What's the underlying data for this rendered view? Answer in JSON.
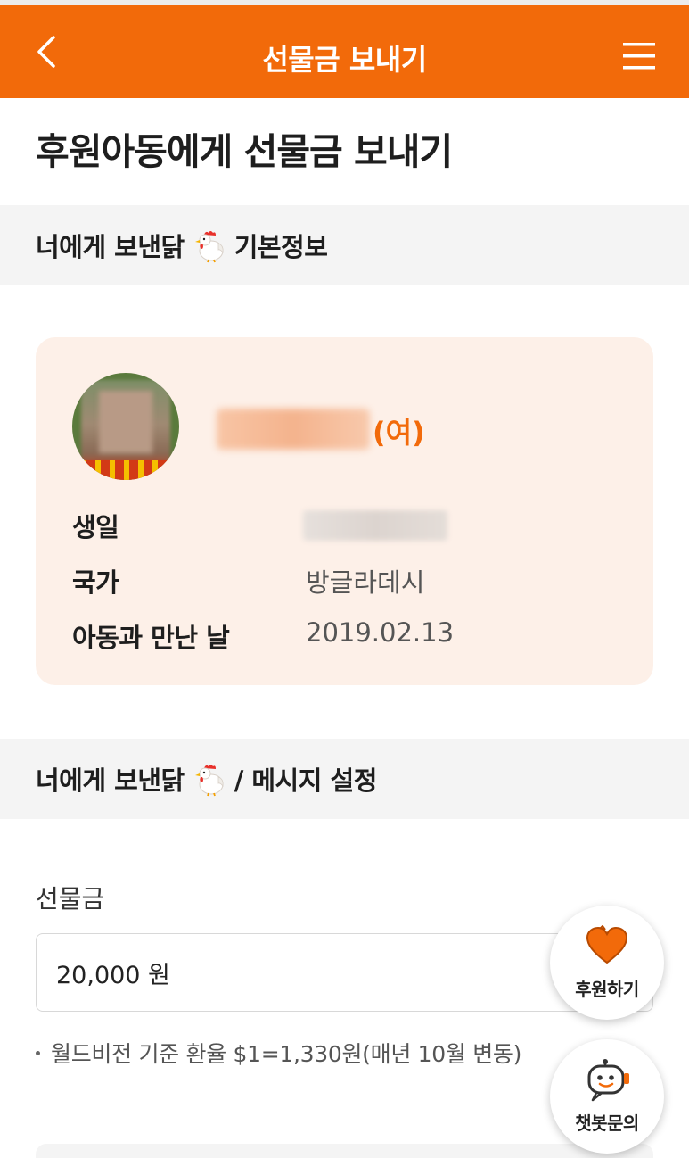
{
  "header": {
    "title": "선물금 보내기",
    "back_icon": "chevron-left-icon",
    "menu_icon": "hamburger-menu-icon"
  },
  "page": {
    "title": "후원아동에게 선물금 보내기"
  },
  "section_basic": {
    "title_prefix": "너에게 보낸닭",
    "title_suffix": "기본정보"
  },
  "child": {
    "gender": "(여)",
    "rows": [
      {
        "label": "생일",
        "value": ""
      },
      {
        "label": "국가",
        "value": "방글라데시"
      },
      {
        "label": "아동과 만난 날",
        "value": "2019.02.13"
      }
    ]
  },
  "section_message": {
    "title_prefix": "너에게 보낸닭",
    "title_suffix": "/ 메시지 설정"
  },
  "gift": {
    "label": "선물금",
    "amount": "20,000 원",
    "note": "월드비전 기준 환율 $1=1,330원(매년 10월 변동)"
  },
  "fab": {
    "support_label": "후원하기",
    "chatbot_label": "챗봇문의"
  },
  "colors": {
    "brand": "#f26a0a",
    "card_bg": "#fdf0e8",
    "section_bg": "#f4f4f4"
  }
}
